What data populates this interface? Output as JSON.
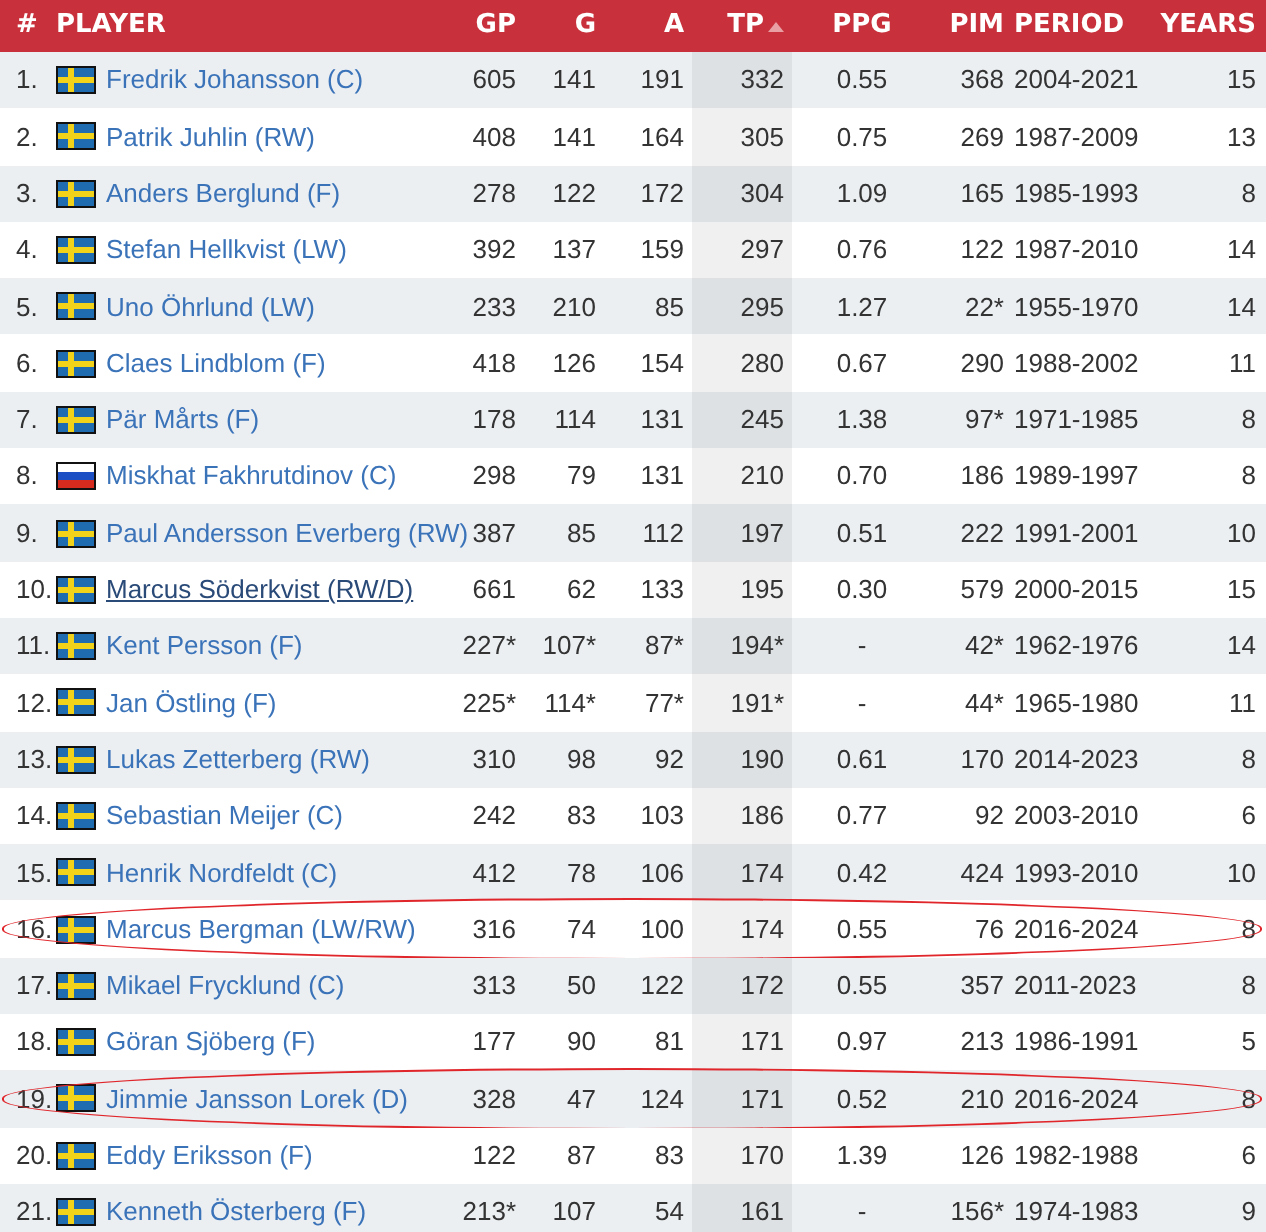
{
  "table": {
    "columns": [
      {
        "label": "#"
      },
      {
        "label": "PLAYER"
      },
      {
        "label": "GP"
      },
      {
        "label": "G"
      },
      {
        "label": "A"
      },
      {
        "label": "TP",
        "sorted": true
      },
      {
        "label": "PPG"
      },
      {
        "label": "PIM"
      },
      {
        "label": "PERIOD"
      },
      {
        "label": "YEARS"
      }
    ],
    "rows": [
      {
        "rank": "1.",
        "kind": "se",
        "player": "Fredrik Johansson (C)",
        "hovered": false,
        "circled": false,
        "stats": [
          "605",
          "141",
          "191",
          "332",
          "0.55",
          "368",
          "2004-2021",
          "15"
        ]
      },
      {
        "rank": "2.",
        "kind": "se",
        "player": "Patrik Juhlin (RW)",
        "hovered": false,
        "circled": false,
        "stats": [
          "408",
          "141",
          "164",
          "305",
          "0.75",
          "269",
          "1987-2009",
          "13"
        ]
      },
      {
        "rank": "3.",
        "kind": "se",
        "player": "Anders Berglund (F)",
        "hovered": false,
        "circled": false,
        "stats": [
          "278",
          "122",
          "172",
          "304",
          "1.09",
          "165",
          "1985-1993",
          "8"
        ]
      },
      {
        "rank": "4.",
        "kind": "se",
        "player": "Stefan Hellkvist (LW)",
        "hovered": false,
        "circled": false,
        "stats": [
          "392",
          "137",
          "159",
          "297",
          "0.76",
          "122",
          "1987-2010",
          "14"
        ]
      },
      {
        "rank": "5.",
        "kind": "se",
        "player": "Uno Öhrlund (LW)",
        "hovered": false,
        "circled": false,
        "stats": [
          "233",
          "210",
          "85",
          "295",
          "1.27",
          "22*",
          "1955-1970",
          "14"
        ]
      },
      {
        "rank": "6.",
        "kind": "se",
        "player": "Claes Lindblom (F)",
        "hovered": false,
        "circled": false,
        "stats": [
          "418",
          "126",
          "154",
          "280",
          "0.67",
          "290",
          "1988-2002",
          "11"
        ]
      },
      {
        "rank": "7.",
        "kind": "se",
        "player": "Pär Mårts (F)",
        "hovered": false,
        "circled": false,
        "stats": [
          "178",
          "114",
          "131",
          "245",
          "1.38",
          "97*",
          "1971-1985",
          "8"
        ]
      },
      {
        "rank": "8.",
        "kind": "ru",
        "player": "Miskhat Fakhrutdinov (C)",
        "hovered": false,
        "circled": false,
        "stats": [
          "298",
          "79",
          "131",
          "210",
          "0.70",
          "186",
          "1989-1997",
          "8"
        ]
      },
      {
        "rank": "9.",
        "kind": "se",
        "player": "Paul Andersson Everberg (RW)",
        "hovered": false,
        "circled": false,
        "stats": [
          "387",
          "85",
          "112",
          "197",
          "0.51",
          "222",
          "1991-2001",
          "10"
        ]
      },
      {
        "rank": "10.",
        "kind": "se",
        "player": "Marcus Söderkvist (RW/D)",
        "hovered": true,
        "circled": false,
        "stats": [
          "661",
          "62",
          "133",
          "195",
          "0.30",
          "579",
          "2000-2015",
          "15"
        ]
      },
      {
        "rank": "11.",
        "kind": "se",
        "player": "Kent Persson (F)",
        "hovered": false,
        "circled": false,
        "stats": [
          "227*",
          "107*",
          "87*",
          "194*",
          "-",
          "42*",
          "1962-1976",
          "14"
        ]
      },
      {
        "rank": "12.",
        "kind": "se",
        "player": "Jan Östling (F)",
        "hovered": false,
        "circled": false,
        "stats": [
          "225*",
          "114*",
          "77*",
          "191*",
          "-",
          "44*",
          "1965-1980",
          "11"
        ]
      },
      {
        "rank": "13.",
        "kind": "se",
        "player": "Lukas Zetterberg (RW)",
        "hovered": false,
        "circled": false,
        "stats": [
          "310",
          "98",
          "92",
          "190",
          "0.61",
          "170",
          "2014-2023",
          "8"
        ]
      },
      {
        "rank": "14.",
        "kind": "se",
        "player": "Sebastian Meijer (C)",
        "hovered": false,
        "circled": false,
        "stats": [
          "242",
          "83",
          "103",
          "186",
          "0.77",
          "92",
          "2003-2010",
          "6"
        ]
      },
      {
        "rank": "15.",
        "kind": "se",
        "player": "Henrik Nordfeldt (C)",
        "hovered": false,
        "circled": false,
        "stats": [
          "412",
          "78",
          "106",
          "174",
          "0.42",
          "424",
          "1993-2010",
          "10"
        ]
      },
      {
        "rank": "16.",
        "kind": "se",
        "player": "Marcus Bergman (LW/RW)",
        "hovered": false,
        "circled": true,
        "stats": [
          "316",
          "74",
          "100",
          "174",
          "0.55",
          "76",
          "2016-2024",
          "8"
        ]
      },
      {
        "rank": "17.",
        "kind": "se",
        "player": "Mikael Frycklund (C)",
        "hovered": false,
        "circled": false,
        "stats": [
          "313",
          "50",
          "122",
          "172",
          "0.55",
          "357",
          "2011-2023",
          "8"
        ]
      },
      {
        "rank": "18.",
        "kind": "se",
        "player": "Göran Sjöberg (F)",
        "hovered": false,
        "circled": false,
        "stats": [
          "177",
          "90",
          "81",
          "171",
          "0.97",
          "213",
          "1986-1991",
          "5"
        ]
      },
      {
        "rank": "19.",
        "kind": "se",
        "player": "Jimmie Jansson Lorek (D)",
        "hovered": false,
        "circled": true,
        "stats": [
          "328",
          "47",
          "124",
          "171",
          "0.52",
          "210",
          "2016-2024",
          "8"
        ]
      },
      {
        "rank": "20.",
        "kind": "se",
        "player": "Eddy Eriksson (F)",
        "hovered": false,
        "circled": false,
        "stats": [
          "122",
          "87",
          "83",
          "170",
          "1.39",
          "126",
          "1982-1988",
          "6"
        ]
      },
      {
        "rank": "21.",
        "kind": "se",
        "player": "Kenneth Österberg (F)",
        "hovered": false,
        "circled": false,
        "stats": [
          "213*",
          "107",
          "54",
          "161",
          "-",
          "156*",
          "1974-1983",
          "9"
        ]
      }
    ]
  }
}
